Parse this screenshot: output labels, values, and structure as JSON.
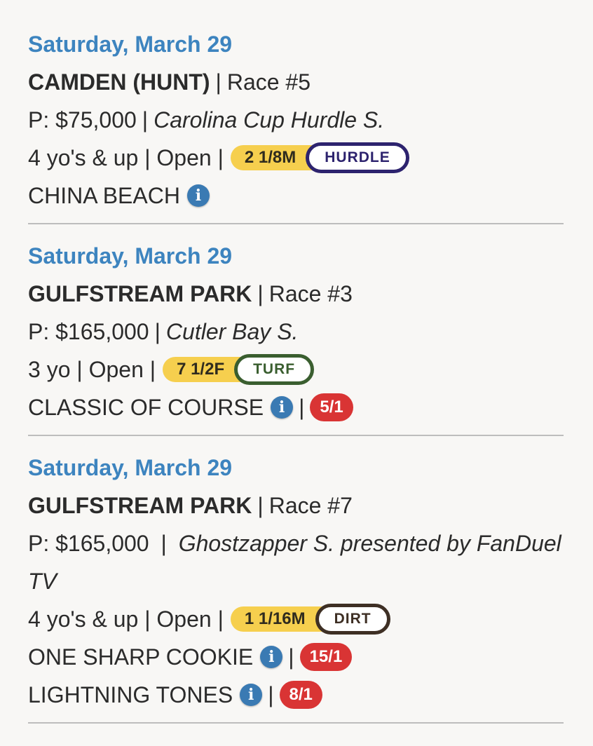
{
  "races": [
    {
      "date": "Saturday, March 29",
      "track": "CAMDEN (HUNT)",
      "race_no": "Race #5",
      "purse": "P: $75,000",
      "stakes": "Carolina Cup Hurdle S.",
      "conditions": "4 yo's & up | Open |",
      "distance": "2 1/8M",
      "surface": "HURDLE",
      "horses": [
        {
          "name": "CHINA BEACH",
          "odds": ""
        }
      ]
    },
    {
      "date": "Saturday, March 29",
      "track": "GULFSTREAM PARK",
      "race_no": "Race #3",
      "purse": "P: $165,000",
      "stakes": "Cutler Bay S.",
      "conditions": "3 yo | Open |",
      "distance": "7 1/2F",
      "surface": "TURF",
      "horses": [
        {
          "name": "CLASSIC OF COURSE",
          "odds": "5/1"
        }
      ]
    },
    {
      "date": "Saturday, March 29",
      "track": "GULFSTREAM PARK",
      "race_no": "Race #7",
      "purse": "P: $165,000",
      "stakes": "Ghostzapper S. presented by FanDuel TV",
      "conditions": "4 yo's & up | Open |",
      "distance": "1 1/16M",
      "surface": "DIRT",
      "horses": [
        {
          "name": "ONE SHARP COOKIE",
          "odds": "15/1"
        },
        {
          "name": "LIGHTNING TONES",
          "odds": "8/1"
        }
      ]
    }
  ],
  "colors": {
    "date": "#3d84bf",
    "distance_pill": "#f6cf4e",
    "hurdle": "#2d236e",
    "turf": "#3a5e2f",
    "dirt": "#3e2f24",
    "odds": "#d93434",
    "info_icon": "#3a7ab3"
  },
  "icons": {
    "info": "info-circle-icon",
    "info_glyph": "i"
  }
}
